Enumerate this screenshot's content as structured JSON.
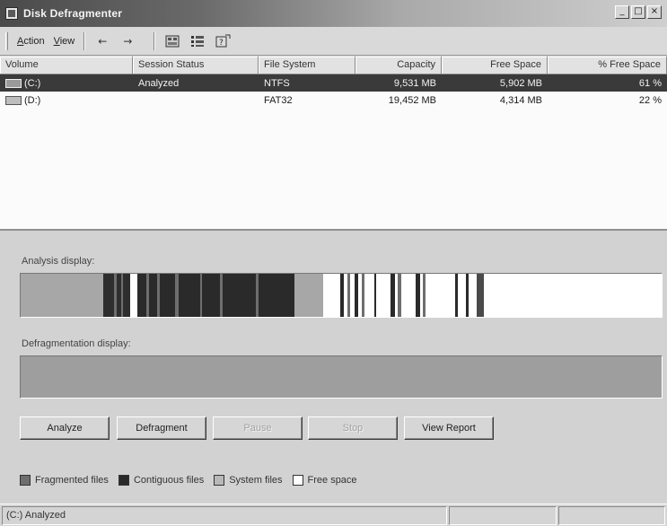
{
  "window": {
    "title": "Disk Defragmenter",
    "controls": [
      "_",
      "□",
      "×"
    ]
  },
  "toolbar": {
    "menus": [
      {
        "label": "Action",
        "underline": "A",
        "rest": "ction"
      },
      {
        "label": "View",
        "underline": "V",
        "rest": "iew"
      }
    ],
    "icons": [
      "back-arrow-icon",
      "forward-arrow-icon",
      "properties-icon",
      "list-view-icon",
      "help-icon"
    ]
  },
  "list": {
    "columns": [
      "Volume",
      "Session Status",
      "File System",
      "Capacity",
      "Free Space",
      "% Free Space"
    ],
    "rows": [
      {
        "volume": "(C:)",
        "status": "Analyzed",
        "fs": "NTFS",
        "capacity": "9,531 MB",
        "free": "5,902 MB",
        "pct": "61 %",
        "selected": true
      },
      {
        "volume": "(D:)",
        "status": "",
        "fs": "FAT32",
        "capacity": "19,452 MB",
        "free": "4,314 MB",
        "pct": "22 %",
        "selected": false
      }
    ]
  },
  "analysis": {
    "label": "Analysis display:"
  },
  "defrag": {
    "label": "Defragmentation display:"
  },
  "buttons": [
    {
      "label": "Analyze",
      "enabled": true
    },
    {
      "label": "Defragment",
      "enabled": true
    },
    {
      "label": "Pause",
      "enabled": false
    },
    {
      "label": "Stop",
      "enabled": false
    },
    {
      "label": "View Report",
      "enabled": true
    }
  ],
  "legend": [
    {
      "label": "Fragmented files",
      "color": "#6e6e6e"
    },
    {
      "label": "Contiguous files",
      "color": "#2a2a2a"
    },
    {
      "label": "System files",
      "color": "#b8b8b8"
    },
    {
      "label": "Free space",
      "color": "#ffffff"
    }
  ],
  "status": {
    "text": "(C:) Analyzed"
  },
  "colors": {
    "selected_row": "#3a3a3a",
    "list_bg": "#fbfbfb",
    "defrag_bar": "#9e9e9e"
  }
}
